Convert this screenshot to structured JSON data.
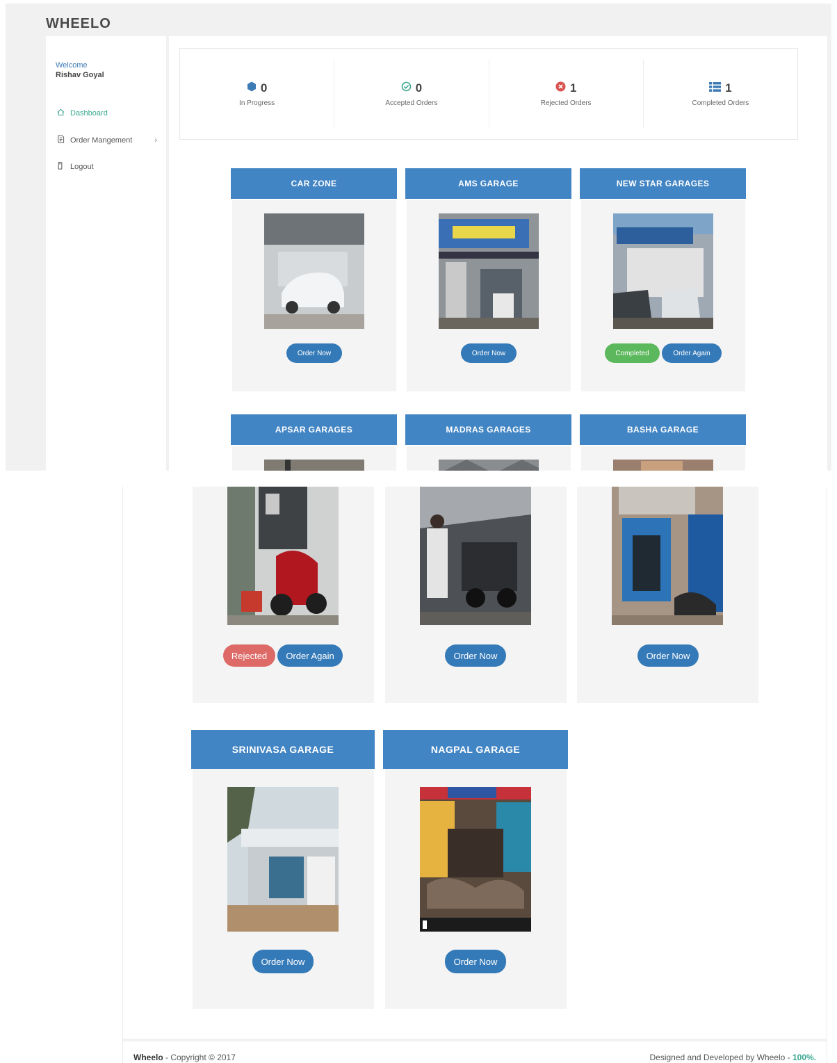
{
  "app": {
    "brand": "WHEELO"
  },
  "sidebar": {
    "welcome": "Welcome",
    "username": "Rishav Goyal",
    "items": [
      {
        "label": "Dashboard",
        "icon": "home-icon"
      },
      {
        "label": "Order Mangement",
        "icon": "document-icon"
      },
      {
        "label": "Logout",
        "icon": "logout-icon"
      }
    ]
  },
  "stats": [
    {
      "value": "0",
      "label": "In Progress",
      "icon": "hexagon-icon",
      "color": "#3c7bb4"
    },
    {
      "value": "0",
      "label": "Accepted Orders",
      "icon": "check-circle-icon",
      "color": "#3aa88f"
    },
    {
      "value": "1",
      "label": "Rejected Orders",
      "icon": "x-circle-icon",
      "color": "#d9534f"
    },
    {
      "value": "1",
      "label": "Completed Orders",
      "icon": "list-icon",
      "color": "#3c7bb4"
    }
  ],
  "garages": [
    {
      "name": "CAR ZONE",
      "status": "",
      "action": "Order Now"
    },
    {
      "name": "AMS GARAGE",
      "status": "",
      "action": "Order Now"
    },
    {
      "name": "NEW STAR GARAGES",
      "status": "Completed",
      "action": "Order Again"
    },
    {
      "name": "APSAR GARAGES",
      "status": "Rejected",
      "action": "Order Again"
    },
    {
      "name": "MADRAS GARAGES",
      "status": "",
      "action": "Order Now"
    },
    {
      "name": "BASHA GARAGE",
      "status": "",
      "action": "Order Now"
    },
    {
      "name": "SRINIVASA GARAGE",
      "status": "",
      "action": "Order Now"
    },
    {
      "name": "NAGPAL GARAGE",
      "status": "",
      "action": "Order Now"
    }
  ],
  "footer": {
    "brand": "Wheelo",
    "copyright": " - Copyright © 2017",
    "credit": "Designed and Developed by Wheelo - ",
    "percent": "100%."
  },
  "colors": {
    "header_blue": "#4285c4",
    "button_blue": "#357ab8",
    "completed_green": "#5cb85c",
    "rejected_red": "#d9534f"
  }
}
